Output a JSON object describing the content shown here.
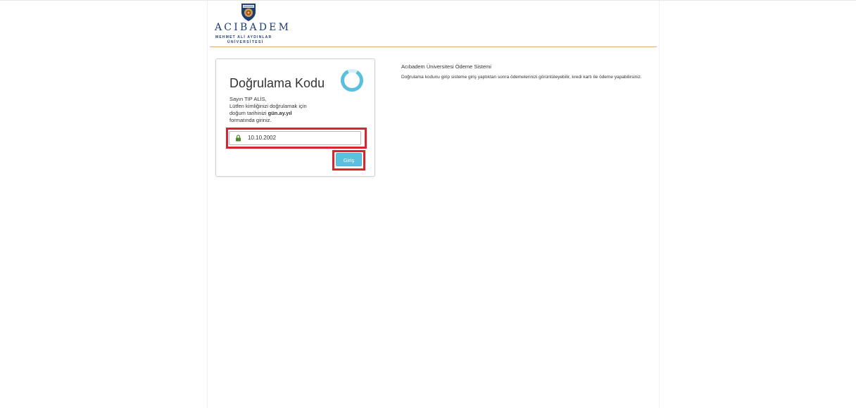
{
  "header": {
    "logo_word": "ACIBADEM",
    "logo_sub1": "MEHMET ALİ AYDINLAR",
    "logo_sub2": "ÜNİVERSİTESİ"
  },
  "card": {
    "title": "Doğrulama Kodu",
    "greeting": "Sayın TIP ALİS,",
    "line1": "Lütfen kimliğinizi doğrulamak için",
    "line2_prefix": "doğum tarihinizi ",
    "line2_format": "gün.ay.yıl",
    "line3": "formatında giriniz.",
    "input_value": "10.10.2002",
    "submit_label": "Giriş"
  },
  "info": {
    "title": "Acıbadem Üniversitesi Ödeme Sistemi",
    "body": "Doğrulama kodunu girip sisteme giriş yaptıktan sonra ödemelerinizi görüntüleyebilir, kredi kartı ile ödeme yapabilirsiniz."
  },
  "colors": {
    "brand_navy": "#1e3d73",
    "gold_rule": "#d4b36a",
    "button_info": "#5bc0de",
    "highlight_red": "#d9232e",
    "spinner": "#5bc0de",
    "lock_green": "#4a8a2a"
  },
  "icons": {
    "logo": "university-seal-icon",
    "spinner": "loading-spinner-icon",
    "lock": "lock-icon"
  }
}
